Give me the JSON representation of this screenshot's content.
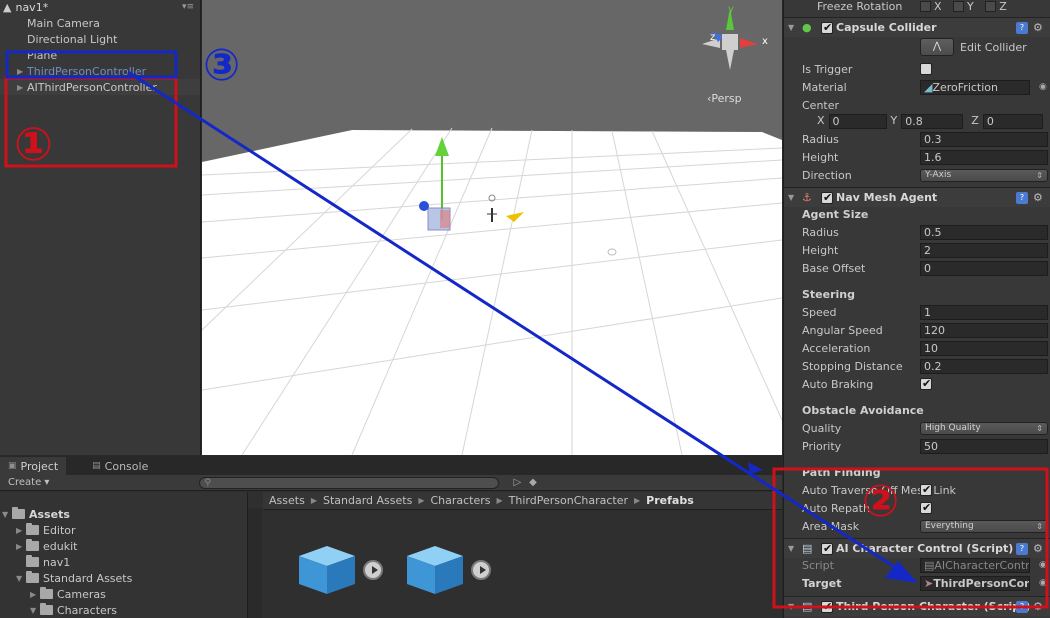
{
  "hierarchy": {
    "scene_name": "nav1*",
    "menu_glyph": "▾≡",
    "items": [
      "Main Camera",
      "Directional Light",
      "Plane",
      "ThirdPersonController",
      "AIThirdPersonController"
    ]
  },
  "scene_view": {
    "persp_label": "‹Persp",
    "gizmo_labels": {
      "x": "x",
      "y": "y",
      "z": "z"
    }
  },
  "project": {
    "tabs": [
      "Project",
      "Console"
    ],
    "create_label": "Create ▾",
    "tree": [
      "Assets",
      "Editor",
      "edukit",
      "nav1",
      "Standard Assets",
      "Cameras",
      "Characters"
    ],
    "breadcrumb": [
      "Assets",
      "Standard Assets",
      "Characters",
      "ThirdPersonCharacter",
      "Prefabs"
    ],
    "separator": "▶"
  },
  "inspector": {
    "freeze_rotation": {
      "label": "Freeze Rotation",
      "axes": [
        "X",
        "Y",
        "Z"
      ]
    },
    "capsule_collider": {
      "title": "Capsule Collider",
      "edit_collider": "Edit Collider",
      "is_trigger": "Is Trigger",
      "material_label": "Material",
      "material_value": "ZeroFriction",
      "center_label": "Center",
      "center": {
        "x_label": "X",
        "x": "0",
        "y_label": "Y",
        "y": "0.8",
        "z_label": "Z",
        "z": "0"
      },
      "radius_label": "Radius",
      "radius": "0.3",
      "height_label": "Height",
      "height": "1.6",
      "direction_label": "Direction",
      "direction": "Y-Axis"
    },
    "nav_mesh_agent": {
      "title": "Nav Mesh Agent",
      "agent_size": "Agent Size",
      "radius_label": "Radius",
      "radius": "0.5",
      "height_label": "Height",
      "height": "2",
      "base_offset_label": "Base Offset",
      "base_offset": "0",
      "steering": "Steering",
      "speed_label": "Speed",
      "speed": "1",
      "angular_speed_label": "Angular Speed",
      "angular_speed": "120",
      "acceleration_label": "Acceleration",
      "acceleration": "10",
      "stopping_distance_label": "Stopping Distance",
      "stopping_distance": "0.2",
      "auto_braking_label": "Auto Braking",
      "obstacle_avoidance": "Obstacle Avoidance",
      "quality_label": "Quality",
      "quality": "High Quality",
      "priority_label": "Priority",
      "priority": "50",
      "path_finding": "Path Finding",
      "auto_traverse_label": "Auto Traverse Off Mesh Link",
      "auto_repath_label": "Auto Repath",
      "area_mask_label": "Area Mask",
      "area_mask": "Everything"
    },
    "ai_character_control": {
      "title": "AI Character Control (Script)",
      "script_label": "Script",
      "script_value": "AICharacterControl",
      "target_label": "Target",
      "target_value": "ThirdPersonController"
    },
    "third_person_character": {
      "title": "Third Person Character (Script)"
    }
  },
  "annotations": {
    "one": "①",
    "two": "②",
    "three": "③",
    "red": "#d0101a",
    "blue": "#1428c8"
  }
}
